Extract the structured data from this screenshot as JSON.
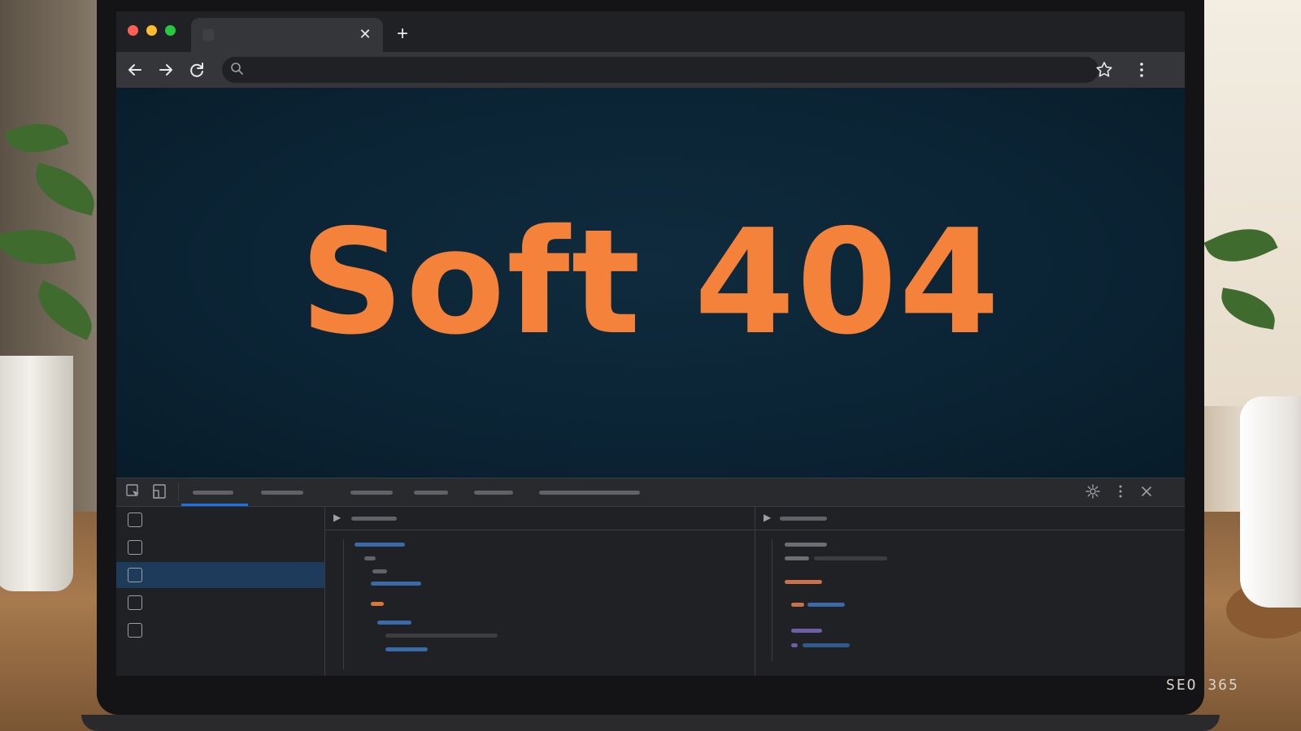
{
  "browser": {
    "tab_title": "",
    "tab_close_glyph": "✕",
    "new_tab_glyph": "+",
    "address": "",
    "traffic_colors": [
      "#ff5f57",
      "#febc2e",
      "#28c840"
    ]
  },
  "page": {
    "heading": "Soft 404",
    "heading_color": "#f5823a"
  },
  "devtools": {
    "selected_sidebar_index": 2
  },
  "watermark": "SEO 365"
}
